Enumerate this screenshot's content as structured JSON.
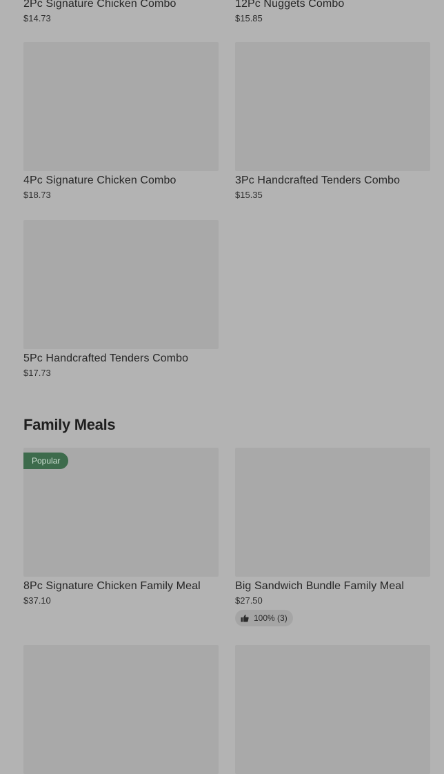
{
  "combos": {
    "items": [
      {
        "name": "2Pc Signature Chicken Combo",
        "price": "$14.73"
      },
      {
        "name": "12Pc Nuggets Combo",
        "price": "$15.85"
      },
      {
        "name": "4Pc Signature Chicken Combo",
        "price": "$18.73"
      },
      {
        "name": "3Pc Handcrafted Tenders Combo",
        "price": "$15.35"
      },
      {
        "name": "5Pc Handcrafted Tenders Combo",
        "price": "$17.73"
      }
    ]
  },
  "family_meals": {
    "title": "Family Meals",
    "items": [
      {
        "name": "8Pc Signature Chicken Family Meal",
        "price": "$37.10",
        "badge": "Popular"
      },
      {
        "name": "Big Sandwich Bundle Family Meal",
        "price": "$27.50",
        "rating_text": "100% (3)",
        "rating_icon": "thumbs-up-icon"
      }
    ]
  }
}
